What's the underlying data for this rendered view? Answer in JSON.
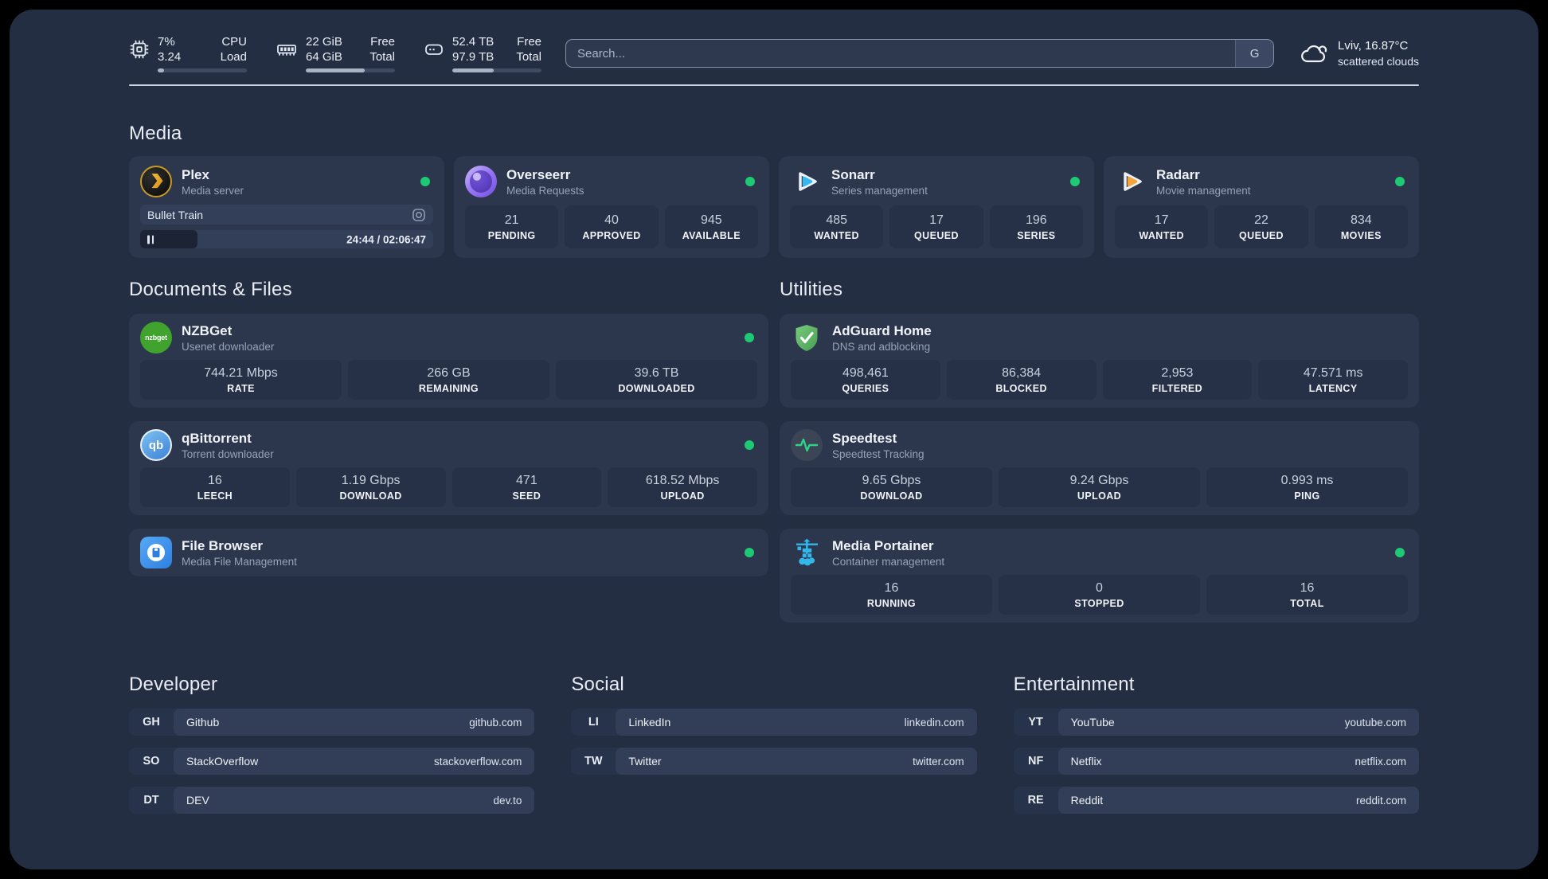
{
  "topbar": {
    "stats": [
      {
        "values": [
          "7%",
          "3.24"
        ],
        "labels": [
          "CPU",
          "Load"
        ],
        "progress": 7
      },
      {
        "values": [
          "22 GiB",
          "64 GiB"
        ],
        "labels": [
          "Free",
          "Total"
        ],
        "progress": 66
      },
      {
        "values": [
          "52.4 TB",
          "97.9 TB"
        ],
        "labels": [
          "Free",
          "Total"
        ],
        "progress": 46
      }
    ],
    "search_placeholder": "Search...",
    "search_button": "G",
    "weather": {
      "line1": "Lviv, 16.87°C",
      "line2": "scattered clouds"
    }
  },
  "sections": {
    "media": {
      "title": "Media"
    },
    "documents": {
      "title": "Documents & Files"
    },
    "utilities": {
      "title": "Utilities"
    }
  },
  "apps": {
    "plex": {
      "name": "Plex",
      "subtitle": "Media server",
      "player": {
        "title": "Bullet Train",
        "time": "24:44 / 02:06:47",
        "progress": 19.5
      }
    },
    "overseerr": {
      "name": "Overseerr",
      "subtitle": "Media Requests",
      "stats": [
        {
          "value": "21",
          "label": "PENDING"
        },
        {
          "value": "40",
          "label": "APPROVED"
        },
        {
          "value": "945",
          "label": "AVAILABLE"
        }
      ]
    },
    "sonarr": {
      "name": "Sonarr",
      "subtitle": "Series management",
      "stats": [
        {
          "value": "485",
          "label": "WANTED"
        },
        {
          "value": "17",
          "label": "QUEUED"
        },
        {
          "value": "196",
          "label": "SERIES"
        }
      ]
    },
    "radarr": {
      "name": "Radarr",
      "subtitle": "Movie management",
      "stats": [
        {
          "value": "17",
          "label": "WANTED"
        },
        {
          "value": "22",
          "label": "QUEUED"
        },
        {
          "value": "834",
          "label": "MOVIES"
        }
      ]
    },
    "nzbget": {
      "name": "NZBGet",
      "subtitle": "Usenet downloader",
      "icon_text": "nzbget",
      "stats": [
        {
          "value": "744.21 Mbps",
          "label": "RATE"
        },
        {
          "value": "266 GB",
          "label": "REMAINING"
        },
        {
          "value": "39.6 TB",
          "label": "DOWNLOADED"
        }
      ]
    },
    "qbittorrent": {
      "name": "qBittorrent",
      "subtitle": "Torrent downloader",
      "icon_text": "qb",
      "stats": [
        {
          "value": "16",
          "label": "LEECH"
        },
        {
          "value": "1.19 Gbps",
          "label": "DOWNLOAD"
        },
        {
          "value": "471",
          "label": "SEED"
        },
        {
          "value": "618.52 Mbps",
          "label": "UPLOAD"
        }
      ]
    },
    "filebrowser": {
      "name": "File Browser",
      "subtitle": "Media File Management"
    },
    "adguard": {
      "name": "AdGuard Home",
      "subtitle": "DNS and adblocking",
      "stats": [
        {
          "value": "498,461",
          "label": "QUERIES"
        },
        {
          "value": "86,384",
          "label": "BLOCKED"
        },
        {
          "value": "2,953",
          "label": "FILTERED"
        },
        {
          "value": "47.571 ms",
          "label": "LATENCY"
        }
      ]
    },
    "speedtest": {
      "name": "Speedtest",
      "subtitle": "Speedtest Tracking",
      "stats": [
        {
          "value": "9.65 Gbps",
          "label": "DOWNLOAD"
        },
        {
          "value": "9.24 Gbps",
          "label": "UPLOAD"
        },
        {
          "value": "0.993 ms",
          "label": "PING"
        }
      ]
    },
    "portainer": {
      "name": "Media Portainer",
      "subtitle": "Container management",
      "stats": [
        {
          "value": "16",
          "label": "RUNNING"
        },
        {
          "value": "0",
          "label": "STOPPED"
        },
        {
          "value": "16",
          "label": "TOTAL"
        }
      ]
    }
  },
  "bookmarks": [
    {
      "title": "Developer",
      "items": [
        {
          "abbr": "GH",
          "name": "Github",
          "url": "github.com"
        },
        {
          "abbr": "SO",
          "name": "StackOverflow",
          "url": "stackoverflow.com"
        },
        {
          "abbr": "DT",
          "name": "DEV",
          "url": "dev.to"
        }
      ]
    },
    {
      "title": "Social",
      "items": [
        {
          "abbr": "LI",
          "name": "LinkedIn",
          "url": "linkedin.com"
        },
        {
          "abbr": "TW",
          "name": "Twitter",
          "url": "twitter.com"
        }
      ]
    },
    {
      "title": "Entertainment",
      "items": [
        {
          "abbr": "YT",
          "name": "YouTube",
          "url": "youtube.com"
        },
        {
          "abbr": "NF",
          "name": "Netflix",
          "url": "netflix.com"
        },
        {
          "abbr": "RE",
          "name": "Reddit",
          "url": "reddit.com"
        }
      ]
    }
  ],
  "colors": {
    "status_online": "#1ec973",
    "sonarr_accent": "#36b9f1",
    "radarr_accent": "#f4a63a"
  }
}
